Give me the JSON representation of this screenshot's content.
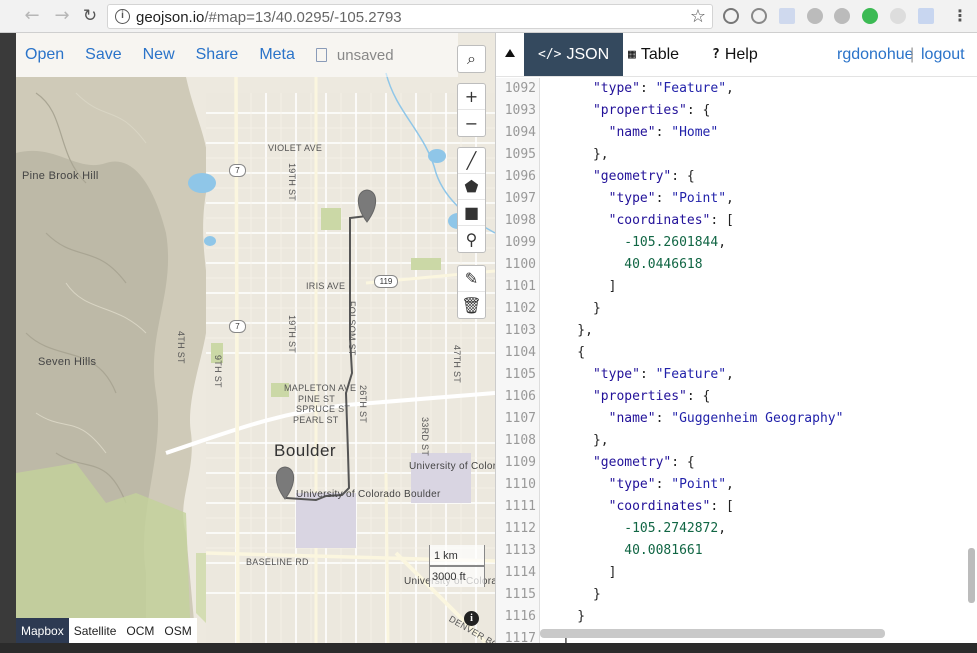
{
  "browser": {
    "url_host": "geojson.io",
    "url_path": "/#map=13/40.0295/-105.2793",
    "back_icon": "arrow-left-icon",
    "forward_icon": "arrow-right-icon",
    "reload_icon": "reload-icon",
    "bookmark_icon": "star-icon"
  },
  "toolbar": {
    "open": "Open",
    "save": "Save",
    "new": "New",
    "share": "Share",
    "meta": "Meta",
    "doc_status": "unsaved"
  },
  "map": {
    "city_label": "Boulder",
    "places": [
      "Pine Brook Hill",
      "Seven Hills"
    ],
    "streets": [
      "VIOLET AVE",
      "IRIS AVE",
      "MAPLETON AVE",
      "PINE ST",
      "SPRUCE ST",
      "PEARL ST",
      "BASELINE RD",
      "19TH ST",
      "19TH ST",
      "4TH ST",
      "9TH ST",
      "26TH ST",
      "33RD ST",
      "47TH ST",
      "FOLSOM ST",
      "DENVER BO"
    ],
    "highways": [
      "7",
      "7",
      "119"
    ],
    "university_label_1": "University of Colorado Boulder",
    "university_label_2": "University of Colorado Boulder",
    "university_label_3": "University of Colorado Boulder",
    "scale_km": "1 km",
    "scale_ft": "3000 ft",
    "layers": [
      "Mapbox",
      "Satellite",
      "OCM",
      "OSM"
    ],
    "active_layer": "Mapbox",
    "colors": {
      "water": "#8fc6e8",
      "park": "#cbd8a6",
      "terrain": "#b9b7a5",
      "route": "#555555",
      "marker": "#7a7a7a"
    }
  },
  "tabs": {
    "json": "JSON",
    "table": "Table",
    "help": "Help",
    "active": "JSON"
  },
  "user": {
    "name": "rgdonohue",
    "logout": "logout"
  },
  "editor": {
    "lines": [
      {
        "n": "1092",
        "text": "      \"type\": \"Feature\","
      },
      {
        "n": "1093",
        "text": "      \"properties\": {"
      },
      {
        "n": "1094",
        "text": "        \"name\": \"Home\""
      },
      {
        "n": "1095",
        "text": "      },"
      },
      {
        "n": "1096",
        "text": "      \"geometry\": {"
      },
      {
        "n": "1097",
        "text": "        \"type\": \"Point\","
      },
      {
        "n": "1098",
        "text": "        \"coordinates\": ["
      },
      {
        "n": "1099",
        "text": "          -105.2601844,"
      },
      {
        "n": "1100",
        "text": "          40.0446618"
      },
      {
        "n": "1101",
        "text": "        ]"
      },
      {
        "n": "1102",
        "text": "      }"
      },
      {
        "n": "1103",
        "text": "    },"
      },
      {
        "n": "1104",
        "text": "    {"
      },
      {
        "n": "1105",
        "text": "      \"type\": \"Feature\","
      },
      {
        "n": "1106",
        "text": "      \"properties\": {"
      },
      {
        "n": "1107",
        "text": "        \"name\": \"Guggenheim Geography\""
      },
      {
        "n": "1108",
        "text": "      },"
      },
      {
        "n": "1109",
        "text": "      \"geometry\": {"
      },
      {
        "n": "1110",
        "text": "        \"type\": \"Point\","
      },
      {
        "n": "1111",
        "text": "        \"coordinates\": ["
      },
      {
        "n": "1112",
        "text": "          -105.2742872,"
      },
      {
        "n": "1113",
        "text": "          40.0081661"
      },
      {
        "n": "1114",
        "text": "        ]"
      },
      {
        "n": "1115",
        "text": "      }"
      },
      {
        "n": "1116",
        "text": "    }"
      },
      {
        "n": "1117",
        "text": "  ]"
      }
    ]
  }
}
